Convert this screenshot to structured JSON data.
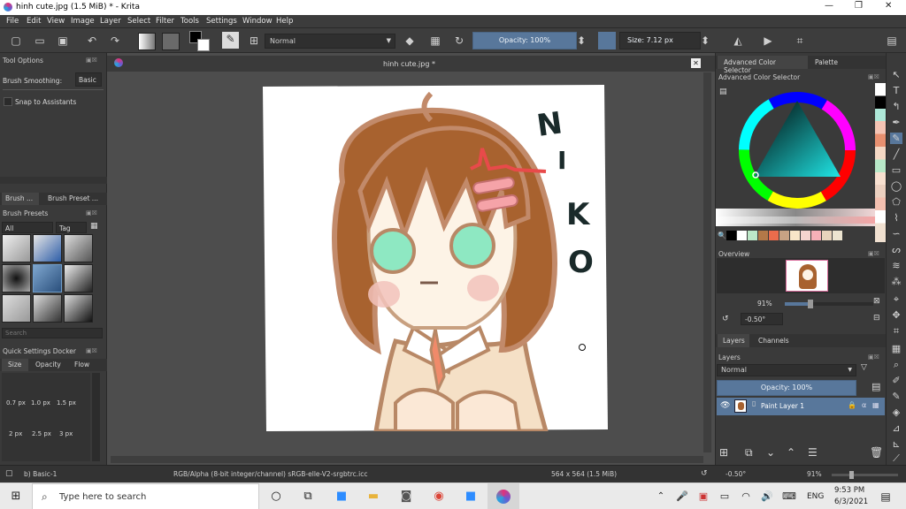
{
  "window": {
    "title": "hinh cute.jpg (1.5 MiB)  * - Krita",
    "minimize": "—",
    "maximize": "❐",
    "close": "✕"
  },
  "menu": [
    "File",
    "Edit",
    "View",
    "Image",
    "Layer",
    "Select",
    "Filter",
    "Tools",
    "Settings",
    "Window",
    "Help"
  ],
  "toolbar": {
    "blend_mode": "Normal",
    "opacity": "Opacity: 100%",
    "size": "Size: 7.12 px"
  },
  "tool_options": {
    "title": "Tool Options",
    "brush_smoothing_label": "Brush Smoothing:",
    "brush_smoothing_value": "Basic",
    "snap_label": "Snap to Assistants"
  },
  "brush_tabs": [
    "Brush ...",
    "Brush Preset ..."
  ],
  "brush_presets": {
    "title": "Brush Presets",
    "filter": "All",
    "tag": "Tag",
    "search_placeholder": "Search"
  },
  "quick_settings": {
    "title": "Quick Settings Docker",
    "tabs": [
      "Size",
      "Opacity",
      "Flow"
    ],
    "sizes": [
      "0.7 px",
      "1.0 px",
      "1.5 px",
      "2 px",
      "2.5 px",
      "3 px"
    ]
  },
  "document": {
    "tab": "hinh cute.jpg *"
  },
  "canvas_text": [
    "N",
    "I",
    "K",
    "O"
  ],
  "color_selector": {
    "tab1": "Advanced Color Selector",
    "tab2": "Palette",
    "title": "Advanced Color Selector"
  },
  "overview": {
    "title": "Overview",
    "zoom": "91%",
    "rotation": "-0.50°"
  },
  "layers": {
    "tab1": "Layers",
    "tab2": "Channels",
    "title": "Layers",
    "blend": "Normal",
    "opacity": "Opacity:  100%",
    "layer_name": "Paint Layer 1"
  },
  "status": {
    "brush": "b) Basic-1",
    "color_info": "RGB/Alpha (8-bit integer/channel)  sRGB-elle-V2-srgbtrc.icc",
    "dimensions": "564 x 564 (1.5 MiB)",
    "rotation": "-0.50°",
    "zoom": "91%"
  },
  "taskbar": {
    "search_placeholder": "Type here to search",
    "lang": "ENG",
    "time": "9:53 PM",
    "date": "6/3/2021"
  },
  "colors": {
    "accent": "#58779b",
    "bg": "#3a3a3a",
    "hair": "#a8622f",
    "eyes": "#8ee8c2"
  }
}
